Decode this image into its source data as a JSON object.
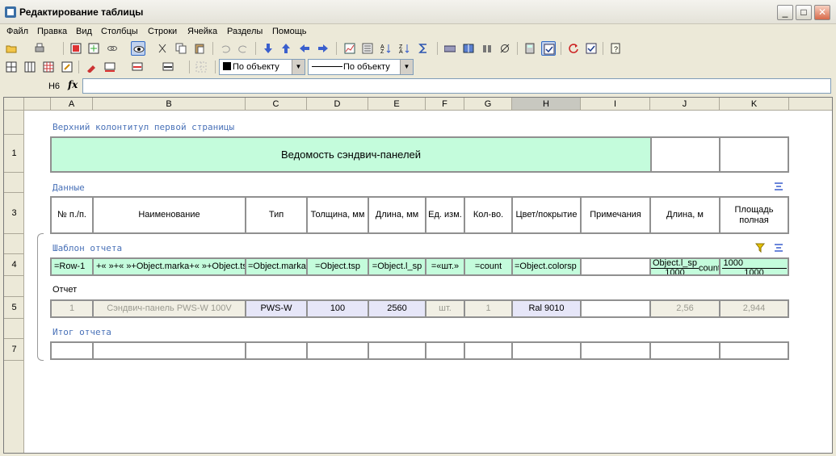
{
  "window": {
    "title": "Редактирование таблицы",
    "btn_min": "_",
    "btn_max": "□",
    "btn_close": "✕"
  },
  "menu": [
    "Файл",
    "Правка",
    "Вид",
    "Столбцы",
    "Строки",
    "Ячейка",
    "Разделы",
    "Помощь"
  ],
  "toolbar2": {
    "color_select": "По объекту",
    "line_select": "По объекту"
  },
  "formula": {
    "cell_ref": "H6",
    "fx": "fx",
    "value": ""
  },
  "columns": [
    "A",
    "B",
    "C",
    "D",
    "E",
    "F",
    "G",
    "H",
    "I",
    "J",
    "K"
  ],
  "selected_column": "H",
  "rows": [
    "1",
    "3",
    "4",
    "5",
    "7"
  ],
  "sections": {
    "header": "Верхний колонтитул первой страницы",
    "data": "Данные",
    "template": "Шаблон отчета",
    "report": "Отчет",
    "total": "Итог отчета"
  },
  "row1": {
    "title": "Ведомость сэндвич-панелей"
  },
  "row3": [
    "№ п./п.",
    "Наименование",
    "Тип",
    "Толщина, мм",
    "Длина, мм",
    "Ед. изм.",
    "Кол-во.",
    "Цвет/покрытие",
    "Примечания",
    "Длина, м",
    "Площадь полная"
  ],
  "row4": {
    "a": "=Row-1",
    "b": "+« »+« »+Object.marka+« »+Object.tsp",
    "c": "=Object.marka",
    "d": "=Object.tsp",
    "e": "=Object.l_sp",
    "f": "=«шт.»",
    "g": "=count",
    "h": "=Object.colorsp",
    "i": "",
    "j_num": "Object.l_sp",
    "j_den": "1000",
    "j_suffix": "count",
    "k_num": "1000",
    "k_den": "1000"
  },
  "row5": [
    "1",
    "Сэндвич-панель PWS-W 100V",
    "PWS-W",
    "100",
    "2560",
    "шт.",
    "1",
    "Ral 9010",
    "",
    "2,56",
    "2,944"
  ],
  "colors": {
    "green": "#c4fcdc",
    "blue": "#e6e6f8",
    "section_text": "#4a72b8"
  }
}
